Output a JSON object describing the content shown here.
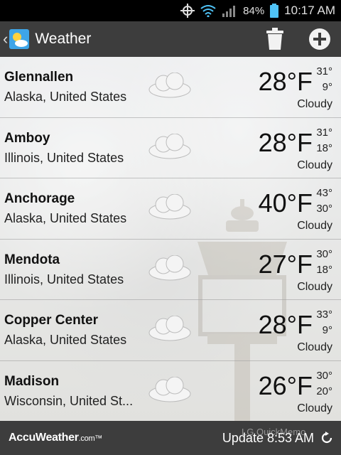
{
  "status": {
    "battery": "84%",
    "time": "10:17 AM"
  },
  "actionbar": {
    "title": "Weather",
    "icons": [
      "back-chevron-icon",
      "weather-app-icon",
      "trash-icon",
      "add-icon"
    ]
  },
  "cities": [
    {
      "name": "Glennallen",
      "region": "Alaska, United States",
      "temp": "28°F",
      "hi": "31°",
      "lo": "9°",
      "cond": "Cloudy"
    },
    {
      "name": "Amboy",
      "region": "Illinois, United States",
      "temp": "28°F",
      "hi": "31°",
      "lo": "18°",
      "cond": "Cloudy"
    },
    {
      "name": "Anchorage",
      "region": "Alaska, United States",
      "temp": "40°F",
      "hi": "43°",
      "lo": "30°",
      "cond": "Cloudy"
    },
    {
      "name": "Mendota",
      "region": "Illinois, United States",
      "temp": "27°F",
      "hi": "30°",
      "lo": "18°",
      "cond": "Cloudy"
    },
    {
      "name": "Copper Center",
      "region": "Alaska, United States",
      "temp": "28°F",
      "hi": "33°",
      "lo": "9°",
      "cond": "Cloudy"
    },
    {
      "name": "Madison",
      "region": "Wisconsin, United St...",
      "temp": "26°F",
      "hi": "30°",
      "lo": "20°",
      "cond": "Cloudy"
    }
  ],
  "footer": {
    "brand": "AccuWeather",
    "brand_suffix": ".com™",
    "update": "Update 8:53 AM",
    "watermark": "LG QuickMemo"
  }
}
